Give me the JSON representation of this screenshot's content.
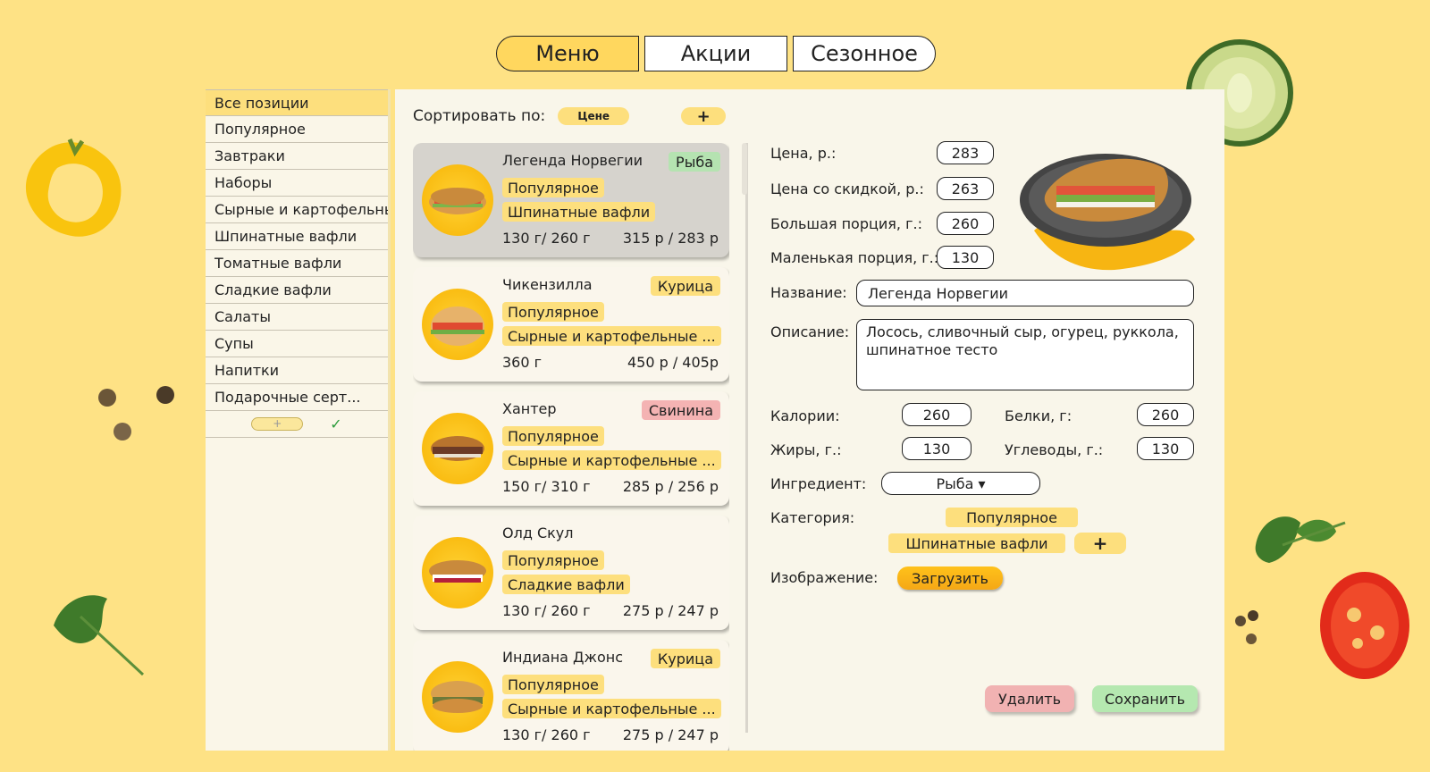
{
  "tabs": [
    {
      "label": "Меню"
    },
    {
      "label": "Акции"
    },
    {
      "label": "Сезонное"
    }
  ],
  "sidebar": {
    "items": [
      {
        "label": "Все позиции"
      },
      {
        "label": "Популярное"
      },
      {
        "label": "Завтраки"
      },
      {
        "label": "Наборы"
      },
      {
        "label": "Сырные и картофельные вафли"
      },
      {
        "label": "Шпинатные вафли"
      },
      {
        "label": "Томатные вафли"
      },
      {
        "label": "Сладкие вафли"
      },
      {
        "label": "Салаты"
      },
      {
        "label": "Супы"
      },
      {
        "label": "Напитки"
      },
      {
        "label": "Подарочные серт..."
      }
    ],
    "add_label": "+",
    "confirm_label": "✓"
  },
  "sort": {
    "label": "Сортировать по:",
    "chip": "Цене",
    "add": "+"
  },
  "cards": [
    {
      "title": "Легенда Норвегии",
      "tag": "Рыба",
      "chips": [
        "Популярное",
        "Шпинатные вафли"
      ],
      "weight": "130 г/ 260 г",
      "price": "315 р / 283 р"
    },
    {
      "title": "Чикензилла",
      "tag": "Курица",
      "chips": [
        "Популярное",
        "Сырные и картофельные ..."
      ],
      "weight": "360 г",
      "price": "450 р / 405р"
    },
    {
      "title": "Хантер",
      "tag": "Свинина",
      "chips": [
        "Популярное",
        "Сырные и картофельные ..."
      ],
      "weight": "150 г/ 310 г",
      "price": "285 р / 256 р"
    },
    {
      "title": "Олд Скул",
      "tag": "",
      "chips": [
        "Популярное",
        "Сладкие вафли"
      ],
      "weight": "130 г/ 260 г",
      "price": "275 р / 247 р"
    },
    {
      "title": "Индиана Джонс",
      "tag": "Курица",
      "chips": [
        "Популярное",
        "Сырные и картофельные ..."
      ],
      "weight": "130 г/ 260 г",
      "price": "275 р / 247 р"
    }
  ],
  "form": {
    "price_label": "Цена, р.:",
    "price_value": "283",
    "discount_label": "Цена со скидкой, р.:",
    "discount_value": "263",
    "large_label": "Большая порция, г.:",
    "large_value": "260",
    "small_label": "Маленькая порция, г.:",
    "small_value": "130",
    "name_label": "Название:",
    "name_value": "Легенда Норвегии",
    "desc_label": "Описание:",
    "desc_value": "Лосось, сливочный сыр, огурец, руккола, шпинатное тесто",
    "cal_label": "Калории:",
    "cal_value": "260",
    "protein_label": "Белки, г:",
    "protein_value": "260",
    "fat_label": "Жиры, г.:",
    "fat_value": "130",
    "carb_label": "Углеводы, г.:",
    "carb_value": "130",
    "ingredient_label": "Ингредиент:",
    "ingredient_value": "Рыба ▾",
    "category_label": "Категория:",
    "category_chips": [
      "Популярное",
      "Шпинатные вафли"
    ],
    "category_add": "+",
    "image_label": "Изображение:",
    "upload_label": "Загрузить",
    "delete_label": "Удалить",
    "save_label": "Сохранить"
  }
}
